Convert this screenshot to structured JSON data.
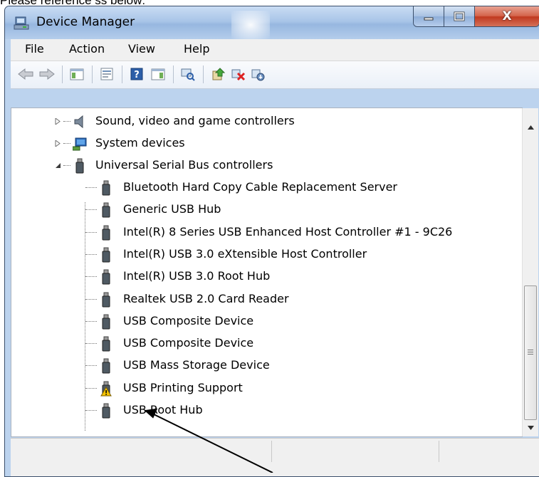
{
  "caption": "Please reference ss below:",
  "window": {
    "title": "Device Manager",
    "controls": [
      "minimize",
      "maximize",
      "close"
    ],
    "close_glyph": "X"
  },
  "menu": [
    "File",
    "Action",
    "View",
    "Help"
  ],
  "toolbar_icons": [
    "back-icon",
    "forward-icon",
    "show-hide-console-tree-icon",
    "properties-icon",
    "help-icon",
    "action-pane-icon",
    "scan-hardware-icon",
    "update-driver-icon",
    "uninstall-device-icon",
    "disable-device-icon"
  ],
  "tree": {
    "categories": [
      {
        "label": "Sound, video and game controllers",
        "icon": "speaker-icon",
        "expanded": false
      },
      {
        "label": "System devices",
        "icon": "computer-icon",
        "expanded": false
      },
      {
        "label": "Universal Serial Bus controllers",
        "icon": "usb-connector-icon",
        "expanded": true
      }
    ],
    "usb_children": [
      {
        "label": "Bluetooth Hard Copy Cable Replacement Server",
        "warning": false
      },
      {
        "label": "Generic USB Hub",
        "warning": false
      },
      {
        "label": "Intel(R) 8 Series USB Enhanced Host Controller #1 - 9C26",
        "warning": false
      },
      {
        "label": "Intel(R) USB 3.0 eXtensible Host Controller",
        "warning": false
      },
      {
        "label": "Intel(R) USB 3.0 Root Hub",
        "warning": false
      },
      {
        "label": "Realtek USB 2.0 Card Reader",
        "warning": false
      },
      {
        "label": "USB Composite Device",
        "warning": false
      },
      {
        "label": "USB Composite Device",
        "warning": false
      },
      {
        "label": "USB Mass Storage Device",
        "warning": false
      },
      {
        "label": "USB Printing Support",
        "warning": true
      },
      {
        "label": "USB Root Hub",
        "warning": false
      }
    ]
  },
  "colors": {
    "title_bar": "#a9c5e8",
    "close_button": "#c0391f",
    "warning": "#f5c400",
    "content_bg": "#ffffff"
  }
}
